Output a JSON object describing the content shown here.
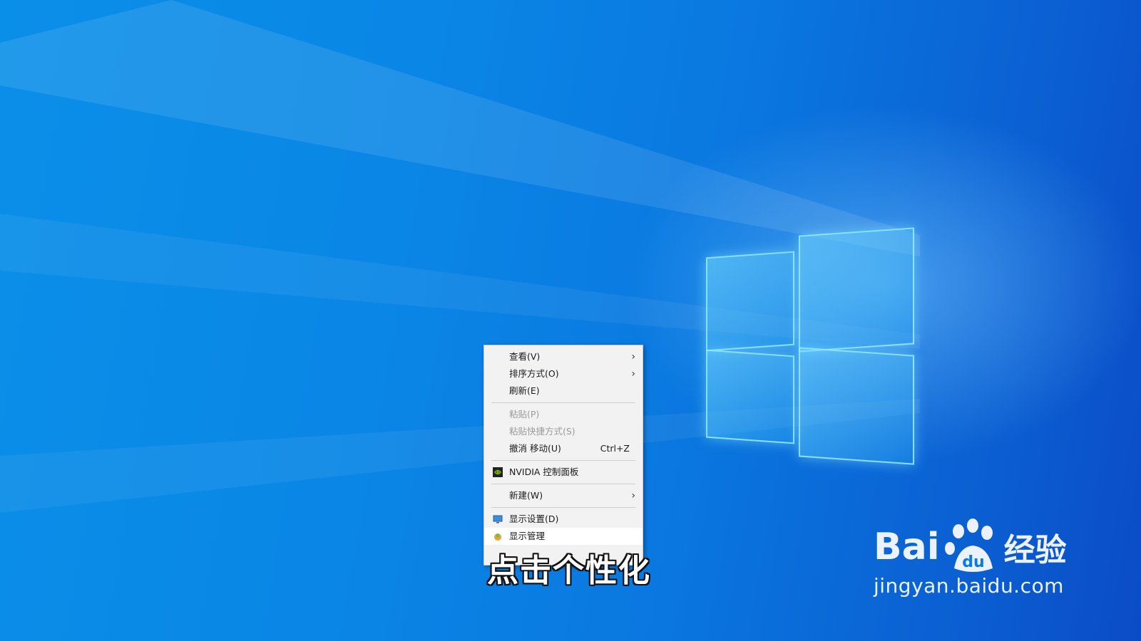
{
  "context_menu": {
    "items": [
      {
        "label": "查看(V)",
        "submenu": true,
        "disabled": false
      },
      {
        "label": "排序方式(O)",
        "submenu": true,
        "disabled": false
      },
      {
        "label": "刷新(E)",
        "submenu": false,
        "disabled": false
      },
      {
        "separator": true
      },
      {
        "label": "粘贴(P)",
        "submenu": false,
        "disabled": true
      },
      {
        "label": "粘贴快捷方式(S)",
        "submenu": false,
        "disabled": true
      },
      {
        "label": "撤消 移动(U)",
        "shortcut": "Ctrl+Z",
        "submenu": false,
        "disabled": false
      },
      {
        "separator": true
      },
      {
        "label": "NVIDIA 控制面板",
        "icon": "nvidia-icon",
        "submenu": false,
        "disabled": false
      },
      {
        "separator": true
      },
      {
        "label": "新建(W)",
        "submenu": true,
        "disabled": false
      },
      {
        "separator": true
      },
      {
        "label": "显示设置(D)",
        "icon": "display-settings-icon",
        "submenu": false,
        "disabled": false
      },
      {
        "label": "显示管理",
        "icon": "display-manager-icon",
        "submenu": false,
        "disabled": false,
        "hovered": true
      }
    ]
  },
  "caption": "点击个性化",
  "watermark": {
    "brand_left": "Bai",
    "brand_right": "经验",
    "url": "jingyan.baidu.com"
  },
  "colors": {
    "desktop_blue": "#0a86e6",
    "menu_bg": "#f2f2f2"
  }
}
